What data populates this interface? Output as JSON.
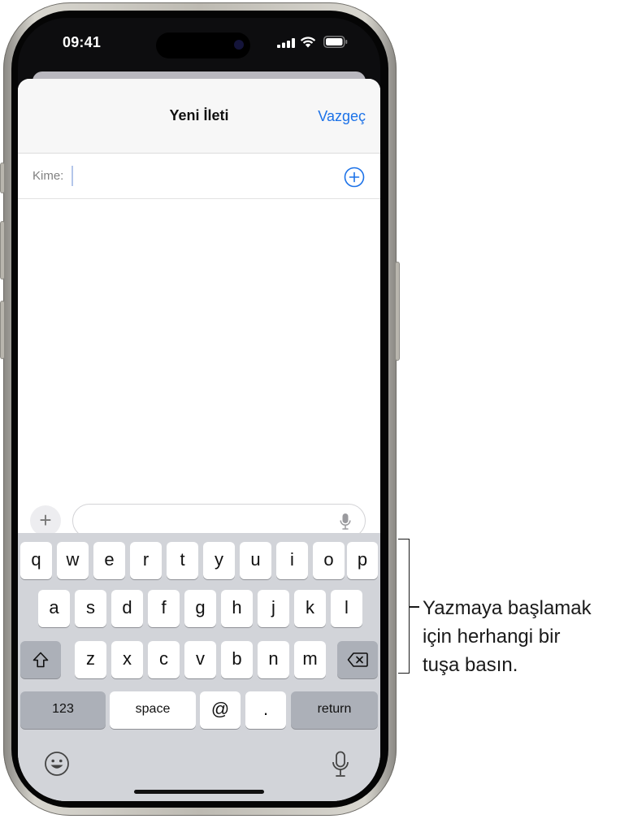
{
  "status_bar": {
    "time": "09:41"
  },
  "sheet": {
    "title": "Yeni İleti",
    "cancel_label": "Vazgeç",
    "to_label": "Kime:"
  },
  "compose": {
    "message_value": ""
  },
  "keyboard": {
    "row1": [
      "q",
      "w",
      "e",
      "r",
      "t",
      "y",
      "u",
      "i",
      "o",
      "p"
    ],
    "row2": [
      "a",
      "s",
      "d",
      "f",
      "g",
      "h",
      "j",
      "k",
      "l"
    ],
    "row3": [
      "z",
      "x",
      "c",
      "v",
      "b",
      "n",
      "m"
    ],
    "numbers_label": "123",
    "space_label": "space",
    "at_label": "@",
    "period_label": ".",
    "return_label": "return",
    "icons": {
      "shift": "shift-icon",
      "delete": "delete-icon",
      "emoji": "emoji-icon",
      "dictation": "microphone-icon"
    }
  },
  "callout": {
    "lines": [
      "Yazmaya başlamak",
      "için herhangi bir",
      "tuşa basın."
    ]
  },
  "colors": {
    "accent": "#1c72e8",
    "keyboard_bg": "#d2d4d9",
    "dark_key": "#acb0b8"
  }
}
